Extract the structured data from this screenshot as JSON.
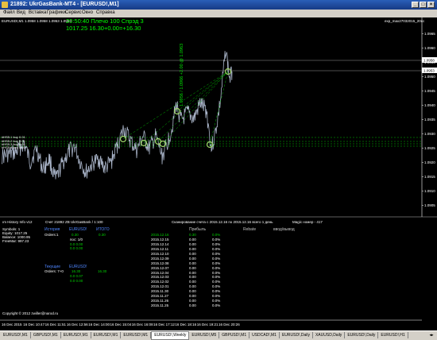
{
  "window": {
    "title": "21892: UkrGasBank-MT4 - [EURUSD!,M1]",
    "min": "_",
    "max": "□",
    "close": "×"
  },
  "menu": [
    "Файл",
    "Вид",
    "Вставка",
    "Графики",
    "Сервис",
    "Окно",
    "Справка"
  ],
  "chart": {
    "header": "EURUSD!,M1  1.0958 1.0958 1.0953 1.0953",
    "top_right_label": "exp_max27032015_20cc",
    "overlay_line1": "20:50:40 Плечо 100 Спрэд 3",
    "overlay_line2": "1017.25  16.30+0.00=+16.30",
    "vertical_text": "1.0956 / 1.0966 +2.00 @ 1.0963",
    "level_labels": [
      "#HS5.1 buy 0.01",
      "#HS5.2 buy 0.01",
      "#HS5.3 buy 0.01",
      "#HS5.4 buy 0.01"
    ],
    "price_axis": [
      "1.0965",
      "1.0960",
      "1.0955",
      "1.0950",
      "1.0945",
      "1.0940",
      "1.0935",
      "1.0930",
      "1.0925",
      "1.0920",
      "1.0915",
      "1.0910",
      "1.0905"
    ],
    "current_price_1": "1.0958",
    "current_price_2": "1.0953",
    "time_axis": [
      "16 Dec 2015",
      "16 Dec 10:47",
      "16 Dec 11:51",
      "16 Dec 12:56",
      "16 Dec 14:00",
      "16 Dec 15:04",
      "16 Dec 16:08",
      "16 Dec 17:12",
      "16 Dec 18:16",
      "16 Dec 19:21",
      "16 Dec 20:26"
    ],
    "colors": {
      "price_line": "#a9b4c8",
      "level_line": "#00c000",
      "accent_text": "#00ff00",
      "background": "#000000"
    }
  },
  "history": {
    "header_left": "ım History Info v12",
    "account": "Счет 21892 ZB UkrGasBank / 1:100",
    "scan": "Сканирование счета с 2015.12.16 по 2015.12.16 всего 1 день",
    "magic": "Magic номер - 417",
    "left_labels": [
      "Symbols: 1",
      "Equity: 1017.25",
      "Balance: 1000.95",
      "FreeMar: 997.23"
    ],
    "sect_history": "История",
    "col_symbol": "EURUSD!",
    "col_total": "ИТОГО",
    "orders_label": "Orders:1",
    "orders_val": "0.30",
    "orders_total": "0.30",
    "sub_label": "пос: 1/0",
    "sub_vals": [
      "0.0  0.00",
      "0.0  0.00"
    ],
    "sect_current": "Текущие",
    "cur_symbol": "EURUSD!",
    "cur_orders_label": "Orders: 7+0",
    "cur_val": "16.30",
    "cur_total": "16.30",
    "cur_sub_vals": [
      "0.0  0.07",
      "0.0  0.00"
    ],
    "copyright": "Copyright © 2012 zwiller@narod.ru",
    "tbl_hdr_profit": "Прибыль",
    "tbl_hdr_rebate": "Rebate",
    "tbl_hdr_io": "ввод/вывод",
    "rows": [
      {
        "date": "2015.12.16",
        "profit": "0.30",
        "pct": "0.0%",
        "hl": true
      },
      {
        "date": "2015.12.15",
        "profit": "0.00",
        "pct": "0.0%"
      },
      {
        "date": "2015.12.14",
        "profit": "0.00",
        "pct": "0.0%"
      },
      {
        "date": "2015.12.11",
        "profit": "0.00",
        "pct": "0.0%"
      },
      {
        "date": "2015.12.10",
        "profit": "0.00",
        "pct": "0.0%"
      },
      {
        "date": "2015.12.09",
        "profit": "0.00",
        "pct": "0.0%"
      },
      {
        "date": "2015.12.08",
        "profit": "0.00",
        "pct": "0.0%"
      },
      {
        "date": "2015.12.07",
        "profit": "0.00",
        "pct": "0.0%"
      },
      {
        "date": "2015.12.04",
        "profit": "0.00",
        "pct": "0.0%"
      },
      {
        "date": "2015.12.03",
        "profit": "0.00",
        "pct": "0.0%"
      },
      {
        "date": "2015.12.02",
        "profit": "0.00",
        "pct": "0.0%"
      },
      {
        "date": "2015.12.01",
        "profit": "0.00",
        "pct": "0.0%"
      },
      {
        "date": "2015.11.30",
        "profit": "0.00",
        "pct": "0.0%"
      },
      {
        "date": "2015.11.27",
        "profit": "0.00",
        "pct": "0.0%"
      },
      {
        "date": "2015.11.26",
        "profit": "0.00",
        "pct": "0.0%"
      },
      {
        "date": "2015.11.25",
        "profit": "0.00",
        "pct": "0.0%"
      }
    ]
  },
  "tabs": [
    "EURUSD!,M1",
    "GBPUSD!,M1",
    "EURUSD!,M1",
    "EURUSD!,M1",
    "EURUSD!,M1",
    "EURUSD!,Weekly",
    "EURUSD!,M5",
    "GBPUSD!,M1",
    "USDCAD!,M1",
    "EURUSD!,Daily",
    "XAUUSD,Daily",
    "EURUSD!,Daily",
    "EURUSD!,H1"
  ],
  "active_tab": 5
}
